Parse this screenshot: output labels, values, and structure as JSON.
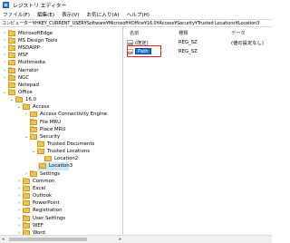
{
  "window": {
    "title": "レジストリ エディター",
    "app_icon": "regedit-icon"
  },
  "menu": [
    "ファイル(F)",
    "編集(E)",
    "表示(V)",
    "お気に入り(A)",
    "ヘルプ(H)"
  ],
  "address": "コンピューター¥HKEY_CURRENT_USER¥Software¥Microsoft¥Office¥16.0¥Access¥Security¥Trusted Locations¥Location3",
  "tree": [
    {
      "label": "MicrosoftEdge",
      "depth": 0,
      "arrow": ">"
    },
    {
      "label": "MS Design Tools",
      "depth": 0,
      "arrow": ">"
    },
    {
      "label": "MSDAIPP",
      "depth": 0,
      "arrow": ">"
    },
    {
      "label": "MSF",
      "depth": 0,
      "arrow": ">"
    },
    {
      "label": "Multimedia",
      "depth": 0,
      "arrow": ">"
    },
    {
      "label": "Narrator",
      "depth": 0,
      "arrow": ">"
    },
    {
      "label": "NGC",
      "depth": 0,
      "arrow": ">"
    },
    {
      "label": "Notepad",
      "depth": 0,
      "arrow": ""
    },
    {
      "label": "Office",
      "depth": 0,
      "arrow": "v"
    },
    {
      "label": "16.0",
      "depth": 1,
      "arrow": "v"
    },
    {
      "label": "Access",
      "depth": 2,
      "arrow": "v"
    },
    {
      "label": "Access Connectivity Engine",
      "depth": 3,
      "arrow": ">"
    },
    {
      "label": "File MRU",
      "depth": 3,
      "arrow": ""
    },
    {
      "label": "Place MRU",
      "depth": 3,
      "arrow": ""
    },
    {
      "label": "Security",
      "depth": 3,
      "arrow": "v"
    },
    {
      "label": "Trusted Documents",
      "depth": 4,
      "arrow": ""
    },
    {
      "label": "Trusted Locations",
      "depth": 4,
      "arrow": "v"
    },
    {
      "label": "Location2",
      "depth": 5,
      "arrow": ""
    },
    {
      "label": "Location3",
      "depth": 5,
      "arrow": "",
      "selected": true
    },
    {
      "label": "Settings",
      "depth": 3,
      "arrow": ">"
    },
    {
      "label": "Common",
      "depth": 2,
      "arrow": ">"
    },
    {
      "label": "Excel",
      "depth": 2,
      "arrow": ">"
    },
    {
      "label": "Outlook",
      "depth": 2,
      "arrow": ">"
    },
    {
      "label": "PowerPoint",
      "depth": 2,
      "arrow": ">"
    },
    {
      "label": "Registration",
      "depth": 2,
      "arrow": ">"
    },
    {
      "label": "User Settings",
      "depth": 2,
      "arrow": ">"
    },
    {
      "label": "WEF",
      "depth": 2,
      "arrow": ">"
    },
    {
      "label": "Word",
      "depth": 2,
      "arrow": ">"
    }
  ],
  "columns": {
    "name": "名前",
    "type": "種類",
    "data": "データ"
  },
  "values": [
    {
      "name": "(既定)",
      "type": "REG_SZ",
      "data": "(値の設定なし)"
    },
    {
      "name": "Path",
      "type": "REG_SZ",
      "data": "",
      "editing": true
    }
  ],
  "colors": {
    "selection": "#cce8ff",
    "edit_highlight": "#1573d8",
    "annotation_box": "#e8202a"
  }
}
